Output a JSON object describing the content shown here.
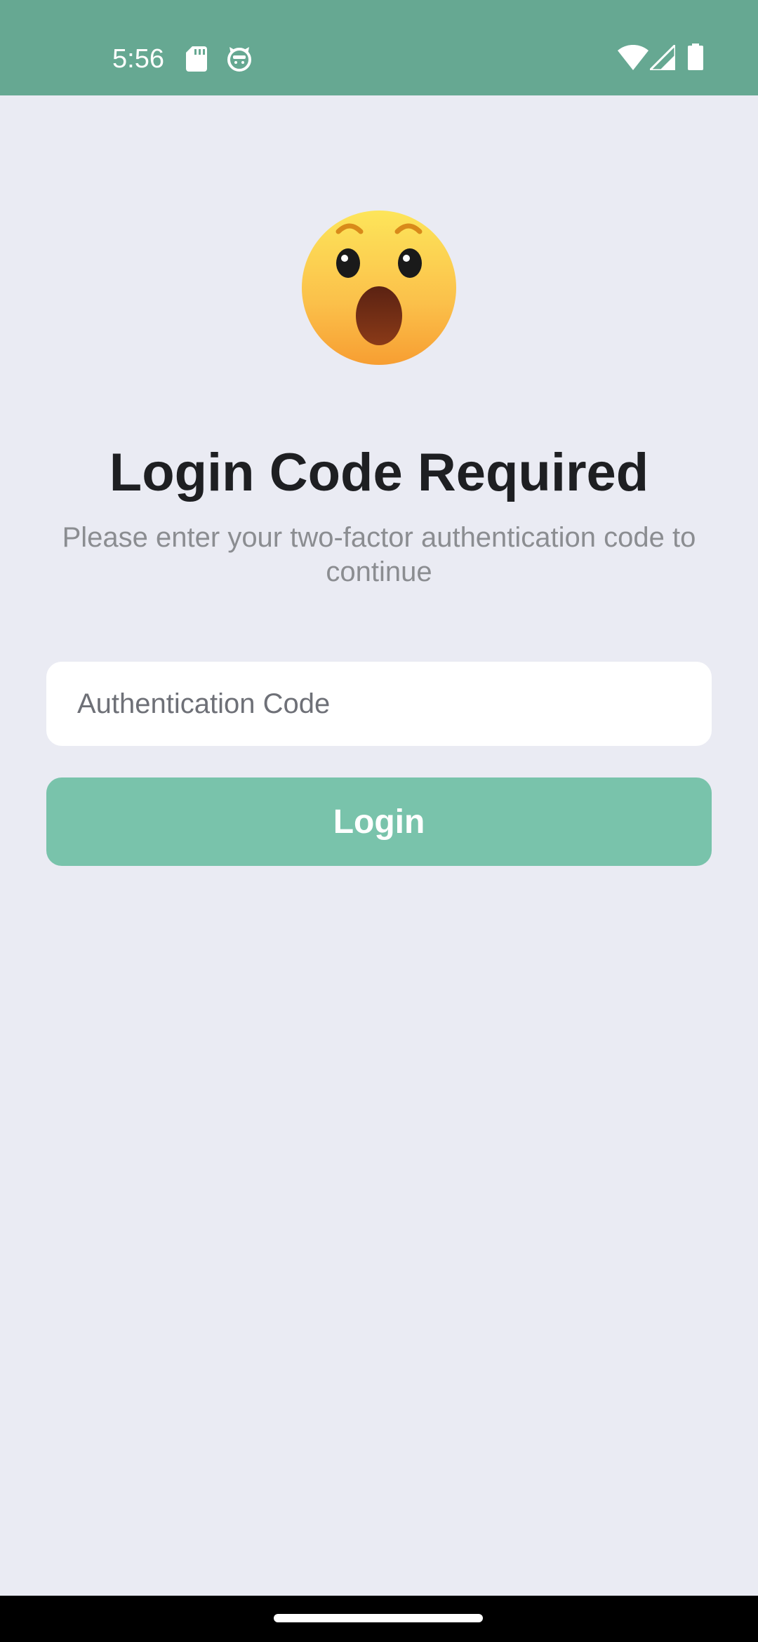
{
  "status_bar": {
    "time": "5:56",
    "background_color": "#66a892",
    "left_icons": [
      "sd-card-icon",
      "cat-face-icon"
    ],
    "right_icons": [
      "wifi-icon",
      "cellular-signal-icon",
      "battery-icon"
    ]
  },
  "login": {
    "emoji_icon": "astonished-face-icon",
    "title": "Login Code Required",
    "subtitle": "Please enter your two-factor authentication code to continue",
    "code_input": {
      "placeholder": "Authentication Code",
      "value": ""
    },
    "login_button_label": "Login",
    "accent_color": "#79c3ab",
    "background_color": "#eaebf3"
  },
  "navigation": {
    "home_indicator_icon": "home-indicator"
  }
}
